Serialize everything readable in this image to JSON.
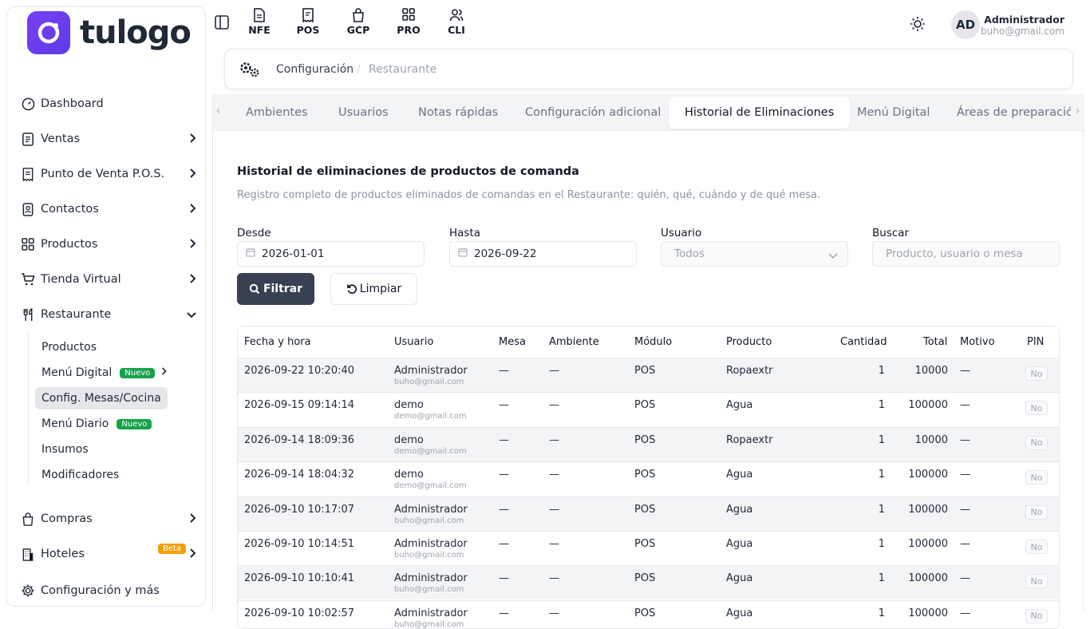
{
  "brand": {
    "name": "tulogo"
  },
  "topbar": {
    "modules": [
      {
        "label": "NFE",
        "icon": "file-icon"
      },
      {
        "label": "POS",
        "icon": "receipt-icon"
      },
      {
        "label": "GCP",
        "icon": "bag-icon"
      },
      {
        "label": "PRO",
        "icon": "grid-icon"
      },
      {
        "label": "CLI",
        "icon": "users-icon"
      }
    ],
    "user": {
      "initials": "AD",
      "name": "Administrador",
      "email": "buho@gmail.com"
    }
  },
  "sidebar": {
    "items": [
      {
        "label": "Dashboard"
      },
      {
        "label": "Ventas"
      },
      {
        "label": "Punto de Venta P.O.S."
      },
      {
        "label": "Contactos"
      },
      {
        "label": "Productos"
      },
      {
        "label": "Tienda Virtual"
      },
      {
        "label": "Restaurante"
      }
    ],
    "sub_items": [
      {
        "label": "Productos"
      },
      {
        "label": "Menú Digital",
        "badge": "Nuevo"
      },
      {
        "label": "Config. Mesas/Cocina"
      },
      {
        "label": "Menú Diario",
        "badge": "Nuevo"
      },
      {
        "label": "Insumos"
      },
      {
        "label": "Modificadores"
      }
    ],
    "bottom_items": [
      {
        "label": "Compras"
      },
      {
        "label": "Hoteles",
        "badge": "Beta"
      },
      {
        "label": "Configuración y más"
      }
    ]
  },
  "breadcrumb": {
    "section": "Configuración",
    "current": "Restaurante"
  },
  "tabs": [
    {
      "label": "Ambientes"
    },
    {
      "label": "Usuarios"
    },
    {
      "label": "Notas rápidas"
    },
    {
      "label": "Configuración adicional"
    },
    {
      "label": "Historial de Eliminaciones",
      "active": true
    },
    {
      "label": "Menú Digital"
    },
    {
      "label": "Áreas de preparación"
    }
  ],
  "section": {
    "title": "Historial de eliminaciones de productos de comanda",
    "description": "Registro completo de productos eliminados de comandas en el Restaurante: quién, qué, cuándo y de qué mesa."
  },
  "filters": {
    "desde_label": "Desde",
    "desde_value": "2026-01-01",
    "hasta_label": "Hasta",
    "hasta_value": "2026-09-22",
    "usuario_label": "Usuario",
    "usuario_value": "Todos",
    "buscar_label": "Buscar",
    "buscar_placeholder": "Producto, usuario o mesa",
    "filter_button": "Filtrar",
    "clear_button": "Limpiar"
  },
  "table": {
    "headers": [
      "Fecha y hora",
      "Usuario",
      "Mesa",
      "Ambiente",
      "Módulo",
      "Producto",
      "Cantidad",
      "Total",
      "Motivo",
      "PIN"
    ],
    "rows": [
      {
        "fecha": "2026-09-22 10:20:40",
        "usuario": "Administrador",
        "email": "buho@gmail.com",
        "mesa": "—",
        "ambiente": "—",
        "modulo": "POS",
        "producto": "Ropaextr",
        "cantidad": "1",
        "total": "10000",
        "motivo": "—",
        "pin": "No"
      },
      {
        "fecha": "2026-09-15 09:14:14",
        "usuario": "demo",
        "email": "demo@gmail.com",
        "mesa": "—",
        "ambiente": "—",
        "modulo": "POS",
        "producto": "Agua",
        "cantidad": "1",
        "total": "100000",
        "motivo": "—",
        "pin": "No"
      },
      {
        "fecha": "2026-09-14 18:09:36",
        "usuario": "demo",
        "email": "demo@gmail.com",
        "mesa": "—",
        "ambiente": "—",
        "modulo": "POS",
        "producto": "Ropaextr",
        "cantidad": "1",
        "total": "10000",
        "motivo": "—",
        "pin": "No"
      },
      {
        "fecha": "2026-09-14 18:04:32",
        "usuario": "demo",
        "email": "demo@gmail.com",
        "mesa": "—",
        "ambiente": "—",
        "modulo": "POS",
        "producto": "Agua",
        "cantidad": "1",
        "total": "100000",
        "motivo": "—",
        "pin": "No"
      },
      {
        "fecha": "2026-09-10 10:17:07",
        "usuario": "Administrador",
        "email": "buho@gmail.com",
        "mesa": "—",
        "ambiente": "—",
        "modulo": "POS",
        "producto": "Agua",
        "cantidad": "1",
        "total": "100000",
        "motivo": "—",
        "pin": "No"
      },
      {
        "fecha": "2026-09-10 10:14:51",
        "usuario": "Administrador",
        "email": "buho@gmail.com",
        "mesa": "—",
        "ambiente": "—",
        "modulo": "POS",
        "producto": "Agua",
        "cantidad": "1",
        "total": "100000",
        "motivo": "—",
        "pin": "No"
      },
      {
        "fecha": "2026-09-10 10:10:41",
        "usuario": "Administrador",
        "email": "buho@gmail.com",
        "mesa": "—",
        "ambiente": "—",
        "modulo": "POS",
        "producto": "Agua",
        "cantidad": "1",
        "total": "100000",
        "motivo": "—",
        "pin": "No"
      },
      {
        "fecha": "2026-09-10 10:02:57",
        "usuario": "Administrador",
        "email": "buho@gmail.com",
        "mesa": "—",
        "ambiente": "—",
        "modulo": "POS",
        "producto": "Agua",
        "cantidad": "1",
        "total": "100000",
        "motivo": "—",
        "pin": "No"
      }
    ]
  },
  "colors": {
    "accent": "#6d3ff0",
    "button_dark": "#374151",
    "badge_new": "#16a34a",
    "badge_beta": "#f59e0b"
  }
}
